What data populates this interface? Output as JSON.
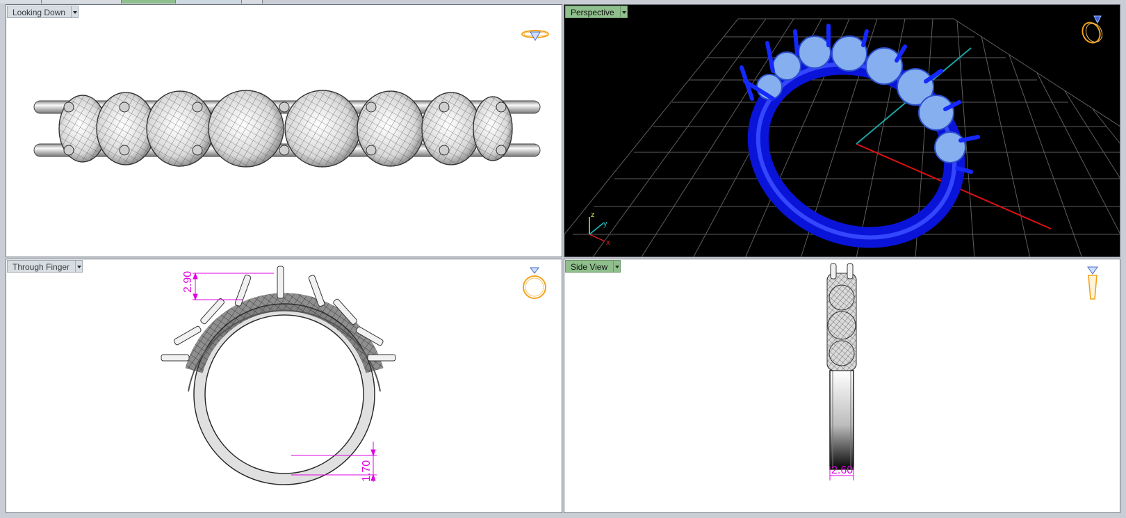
{
  "colors": {
    "workspace": "#c9ced6",
    "viewport_bg_white": "#ffffff",
    "viewport_bg_black": "#000000",
    "active_label": "#8fbf8c",
    "inactive_label": "#d8dde3",
    "ring_blue": "#0a14d8",
    "gem_blue": "#7fa8e8",
    "dimension_magenta": "#e000e0",
    "axis_red": "#dd1111",
    "axis_teal": "#1fa3a3",
    "grid_gray": "#6b6b6b"
  },
  "viewports": {
    "top": {
      "label": "Looking Down",
      "active": false,
      "icon": "ring-top-orientation-icon"
    },
    "perspective": {
      "label": "Perspective",
      "active": true,
      "icon": "ring-perspective-orientation-icon"
    },
    "front": {
      "label": "Through Finger",
      "active": false,
      "icon": "ring-front-orientation-icon",
      "dimensions": {
        "prong_height": "2.90",
        "shank_thickness": "1.70"
      }
    },
    "side": {
      "label": "Side View",
      "active": true,
      "icon": "ring-side-orientation-icon",
      "dimensions": {
        "shank_width": "2.60"
      }
    }
  },
  "axes": {
    "z": "z",
    "y": "y",
    "x": "x"
  }
}
